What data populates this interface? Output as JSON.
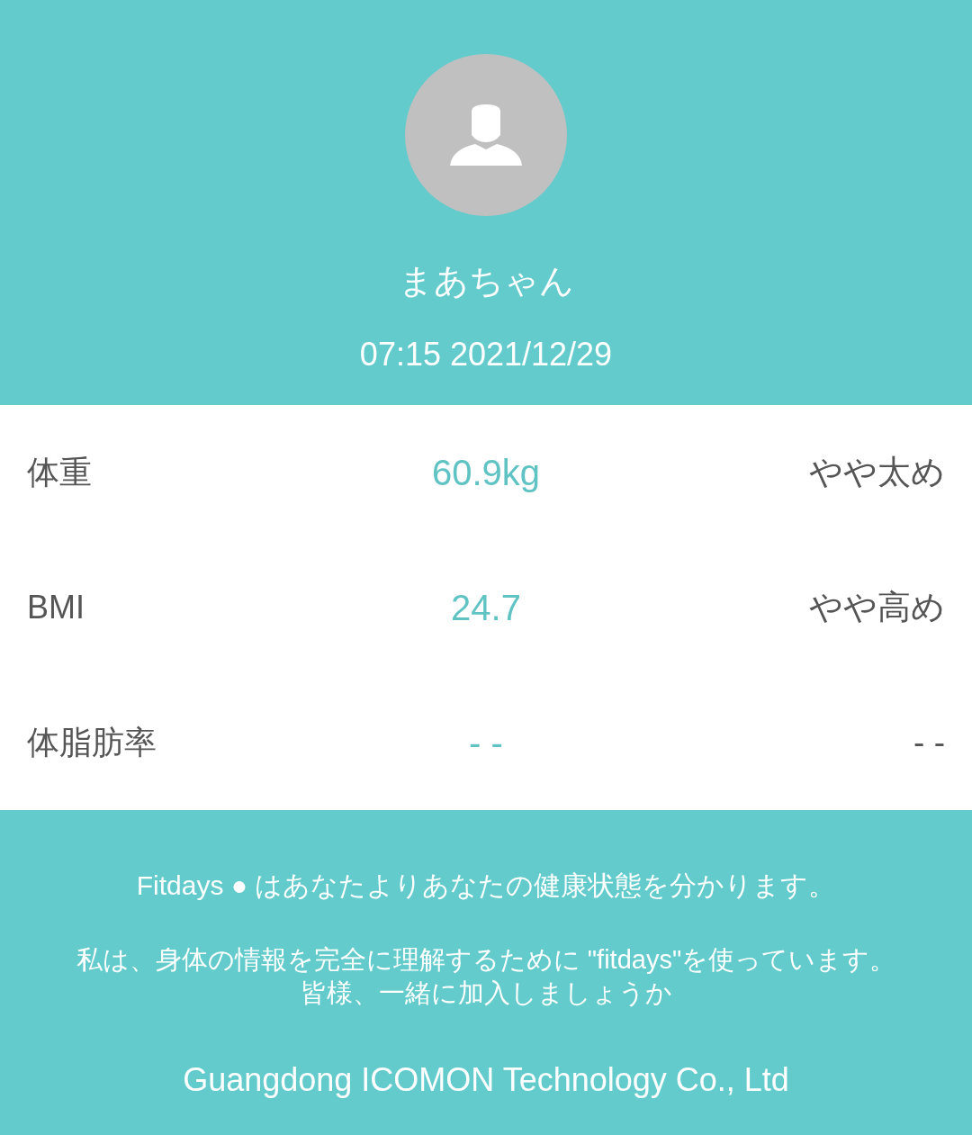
{
  "profile": {
    "name": "まあちゃん",
    "timestamp": "07:15 2021/12/29"
  },
  "metrics": [
    {
      "label": "体重",
      "value": "60.9kg",
      "status": "やや太め"
    },
    {
      "label": "BMI",
      "value": "24.7",
      "status": "やや高め"
    },
    {
      "label": "体脂肪率",
      "value": "- -",
      "status": "- -"
    }
  ],
  "footer": {
    "tagline": "Fitdays ● はあなたよりあなたの健康状態を分かります。",
    "message_lines": [
      "私は、身体の情報を完全に理解するために \"fitdays\"を使っています。",
      "皆様、一緒に加入しましょうか"
    ],
    "company": "Guangdong ICOMON Technology Co., Ltd"
  }
}
